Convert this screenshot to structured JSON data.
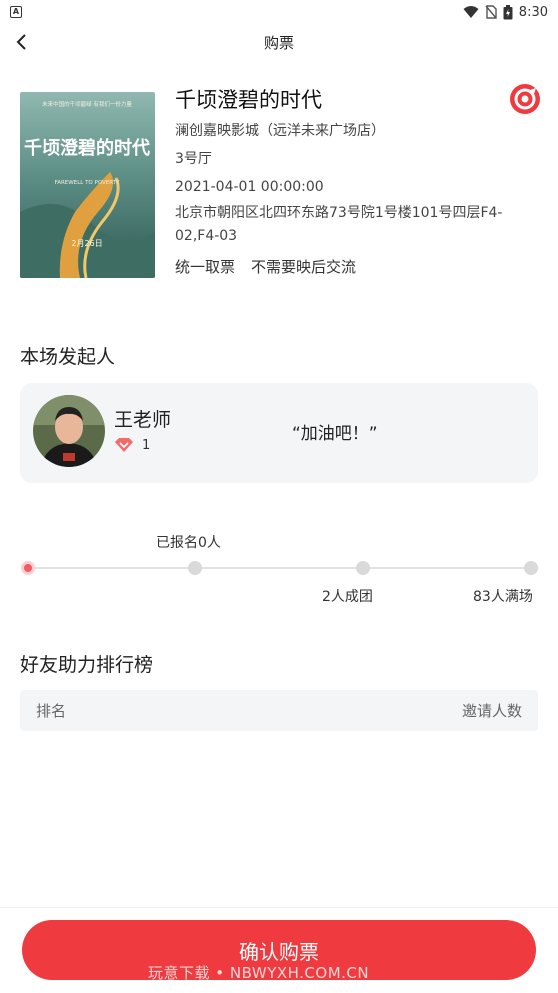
{
  "status_bar": {
    "time": "8:30",
    "app_icon_letter": "A"
  },
  "nav": {
    "title": "购票"
  },
  "movie": {
    "title": "千顷澄碧的时代",
    "cinema": "澜创嘉映影城（远洋未来广场店）",
    "hall": "3号厅",
    "datetime": "2021-04-01 00:00:00",
    "address": "北京市朝阳区北四环东路73号院1号楼101号四层F4-02,F4-03",
    "tags": [
      "统一取票",
      "不需要映后交流"
    ],
    "poster": {
      "title_art": "千顷澄碧的时代",
      "tagline": "未来中国的千顷碧绿 有我们一份力量",
      "english": "FAREWELL TO POVERTY",
      "release": "2月26日"
    },
    "brand_color": "#ef3b3f"
  },
  "sponsor_section": {
    "title": "本场发起人",
    "name": "王老师",
    "level": "1",
    "quote": "“加油吧！”"
  },
  "progress": {
    "signed_label": "已报名0人",
    "milestones": [
      "2人成团",
      "83人满场"
    ],
    "signed_count": 0
  },
  "ranking": {
    "title": "好友助力排行榜",
    "col_rank": "排名",
    "col_invites": "邀请人数"
  },
  "footer": {
    "confirm_label": "确认购票",
    "watermark": "玩意下载 • NBWYXH.COM.CN"
  }
}
